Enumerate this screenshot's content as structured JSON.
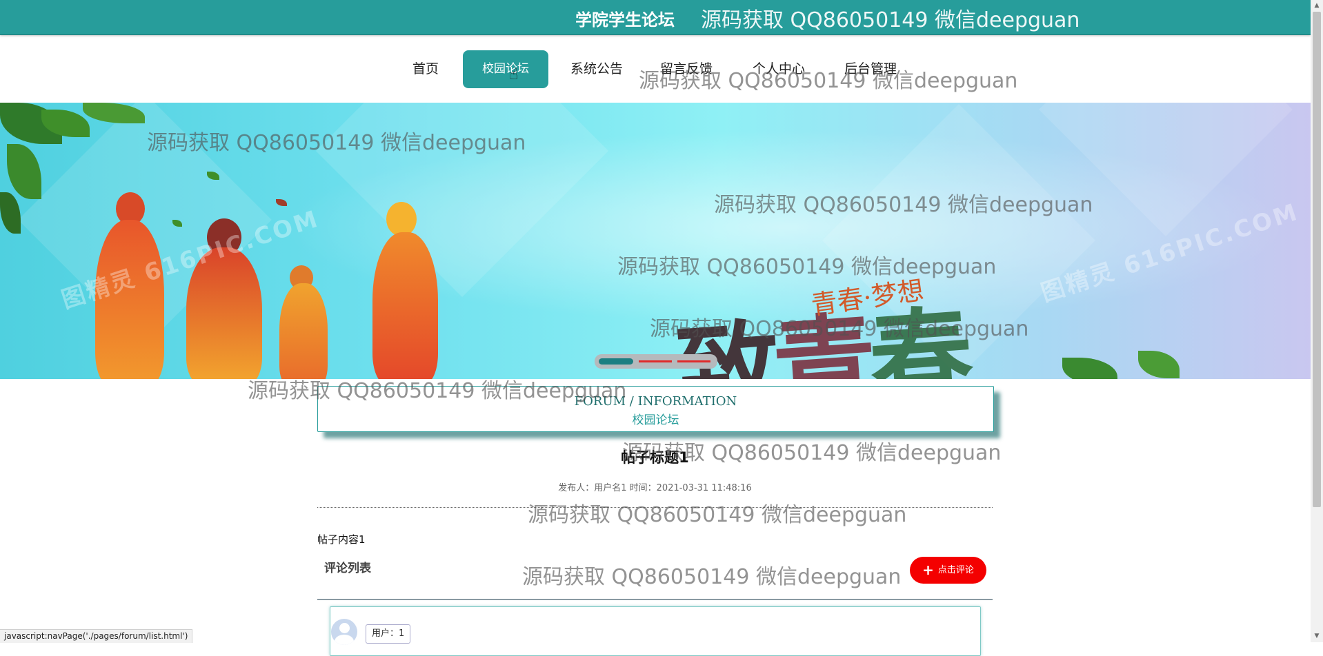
{
  "header": {
    "site_title": "学院学生论坛",
    "watermark": "源码获取 QQ86050149 微信deepguan"
  },
  "nav": {
    "items": [
      {
        "label": "首页"
      },
      {
        "label": "校园论坛",
        "active": true
      },
      {
        "label": "系统公告"
      },
      {
        "label": "留言反馈"
      },
      {
        "label": "个人中心"
      },
      {
        "label": "后台管理"
      }
    ]
  },
  "banner": {
    "main_text": "致青春",
    "sub_text": "青春·梦想",
    "stamp": "图精灵 616PIC.COM",
    "slides": 3,
    "active_slide": 1
  },
  "section": {
    "en_title": "FORUM / INFORMATION",
    "cn_title": "校园论坛"
  },
  "post": {
    "title": "帖子标题1",
    "meta": "发布人：用户名1 时间：2021-03-31 11:48:16",
    "content": "帖子内容1"
  },
  "comments": {
    "label": "评论列表",
    "button_label": "点击评论",
    "items": [
      {
        "user": "用户：1"
      }
    ]
  },
  "status": {
    "link": "javascript:navPage('./pages/forum/list.html')"
  },
  "watermark_text": "源码获取 QQ86050149 微信deepguan",
  "colors": {
    "primary": "#279d9b",
    "danger": "#f40000"
  }
}
